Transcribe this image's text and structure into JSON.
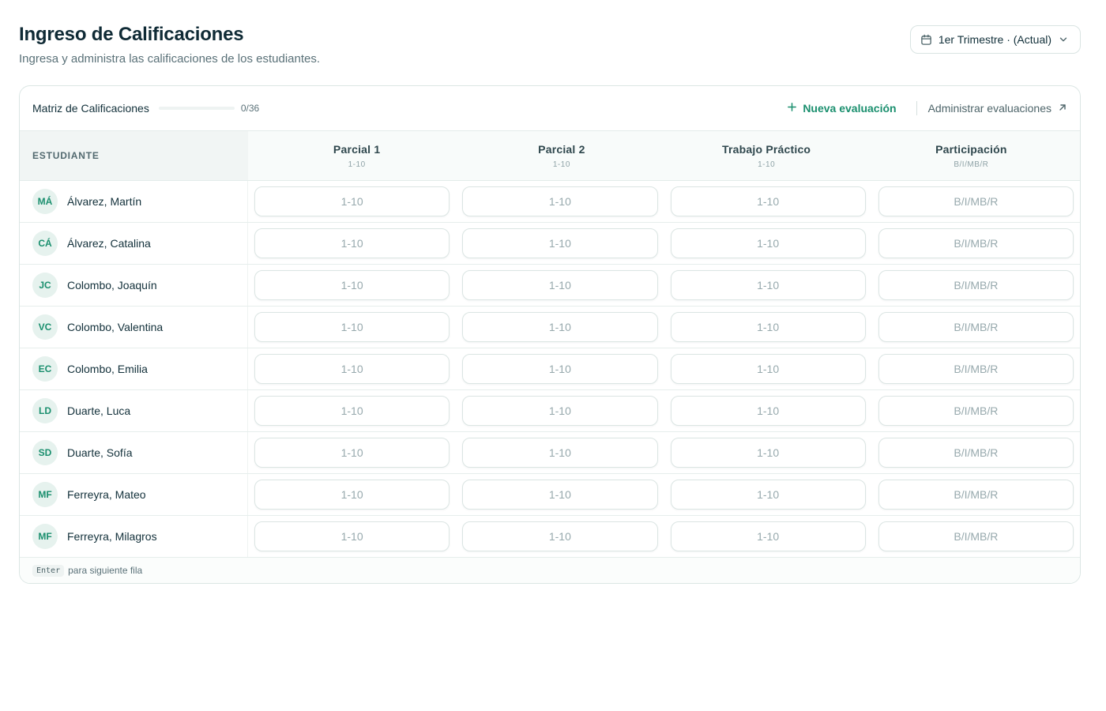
{
  "header": {
    "title": "Ingreso de Calificaciones",
    "subtitle": "Ingresa y administra las calificaciones de los estudiantes."
  },
  "period_selector": {
    "label": "1er Trimestre · (Actual)",
    "icon": "calendar-icon"
  },
  "toolbar": {
    "matrix_label": "Matriz de Calificaciones",
    "progress_fraction": 0,
    "progress_count": "0/36",
    "new_evaluation_label": "Nueva evaluación",
    "manage_evaluations_label": "Administrar evaluaciones"
  },
  "table": {
    "student_header": "ESTUDIANTE",
    "columns": [
      {
        "name": "Parcial 1",
        "scale": "1-10",
        "placeholder": "1-10"
      },
      {
        "name": "Parcial 2",
        "scale": "1-10",
        "placeholder": "1-10"
      },
      {
        "name": "Trabajo Práctico",
        "scale": "1-10",
        "placeholder": "1-10"
      },
      {
        "name": "Participación",
        "scale": "B/I/MB/R",
        "placeholder": "B/I/MB/R"
      }
    ],
    "students": [
      {
        "initials": "MÁ",
        "name": "Álvarez, Martín"
      },
      {
        "initials": "CÁ",
        "name": "Álvarez, Catalina"
      },
      {
        "initials": "JC",
        "name": "Colombo, Joaquín"
      },
      {
        "initials": "VC",
        "name": "Colombo, Valentina"
      },
      {
        "initials": "EC",
        "name": "Colombo, Emilia"
      },
      {
        "initials": "LD",
        "name": "Duarte, Luca"
      },
      {
        "initials": "SD",
        "name": "Duarte, Sofía"
      },
      {
        "initials": "MF",
        "name": "Ferreyra, Mateo"
      },
      {
        "initials": "MF",
        "name": "Ferreyra, Milagros"
      }
    ]
  },
  "footer": {
    "key": "Enter",
    "hint": "para siguiente fila"
  },
  "colors": {
    "accent": "#1a8f6e",
    "title": "#0f2a35",
    "muted": "#5a7178"
  }
}
